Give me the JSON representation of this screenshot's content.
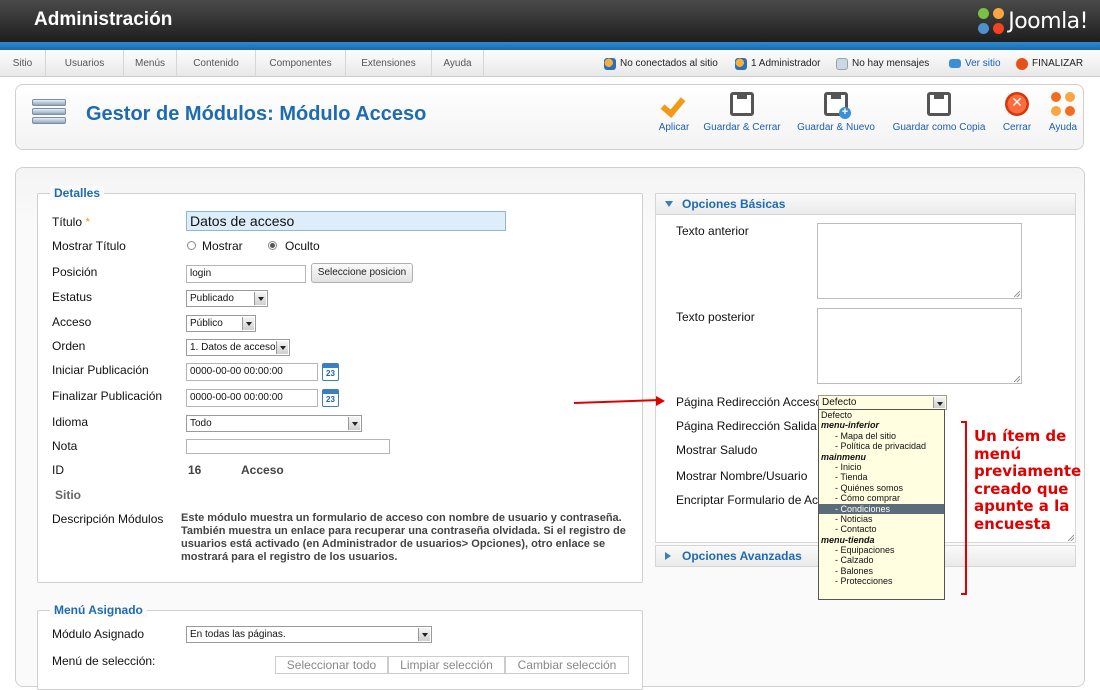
{
  "header": {
    "title": "Administración",
    "logo_text": "Joomla!"
  },
  "menubar": {
    "items": [
      "Sitio",
      "Usuarios",
      "Menús",
      "Contenido",
      "Componentes",
      "Extensiones",
      "Ayuda"
    ]
  },
  "status": {
    "not_connected": "No conectados al sitio",
    "admins": "1 Administrador",
    "messages": "No hay mensajes",
    "view_site": "Ver sitio",
    "logout": "FINALIZAR"
  },
  "toolbar": {
    "page_title": "Gestor de Módulos: Módulo Acceso",
    "buttons": {
      "apply": "Aplicar",
      "save_close": "Guardar & Cerrar",
      "save_new": "Guardar & Nuevo",
      "save_copy": "Guardar como Copia",
      "close": "Cerrar",
      "help": "Ayuda"
    }
  },
  "details": {
    "legend": "Detalles",
    "title_label": "Título",
    "required_mark": "*",
    "title_value": "Datos de acceso",
    "show_title_label": "Mostrar Título",
    "show_option": "Mostrar",
    "hide_option": "Oculto",
    "position_label": "Posición",
    "position_value": "login",
    "select_position_button": "Seleccione posicion",
    "status_label": "Estatus",
    "status_value": "Publicado",
    "access_label": "Acceso",
    "access_value": "Público",
    "order_label": "Orden",
    "order_value": "1. Datos de acceso",
    "start_label": "Iniciar Publicación",
    "start_value": "0000-00-00 00:00:00",
    "finish_label": "Finalizar Publicación",
    "finish_value": "0000-00-00 00:00:00",
    "calendar_text": "23",
    "language_label": "Idioma",
    "language_value": "Todo",
    "note_label": "Nota",
    "note_value": "",
    "id_label": "ID",
    "id_value": "16",
    "id_type": "Acceso",
    "site_label": "Sitio",
    "description_label": "Descripción Módulos",
    "description_text": "Este módulo muestra un formulario de acceso con nombre de usuario y contraseña. También muestra un enlace para recuperar una contraseña olvidada. Si el registro de usuarios está activado (en Administrador de usuarios> Opciones), otro enlace se mostrará para el registro de los usuarios."
  },
  "menu_assignment": {
    "legend": "Menú Asignado",
    "assigned_label": "Módulo Asignado",
    "assigned_value": "En todas las páginas.",
    "selection_label": "Menú de selección:",
    "select_all": "Seleccionar todo",
    "clear_selection": "Limpiar selección",
    "toggle_selection": "Cambiar selección"
  },
  "basic_options": {
    "header": "Opciones Básicas",
    "pretext_label": "Texto anterior",
    "posttext_label": "Texto posterior",
    "login_redirect_label": "Página Redirección Acceso",
    "login_redirect_value": "Defecto",
    "logout_redirect_label": "Página Redirección Salida",
    "greeting_label": "Mostrar Saludo",
    "name_label": "Mostrar Nombre/Usuario",
    "encrypt_label": "Encriptar Formulario de Acce"
  },
  "advanced_options": {
    "header": "Opciones Avanzadas"
  },
  "dropdown": {
    "items": [
      {
        "text": "Defecto",
        "kind": "plain"
      },
      {
        "text": "menu-inferior",
        "kind": "group"
      },
      {
        "text": "- Mapa del sitio",
        "kind": "child"
      },
      {
        "text": "- Política de privacidad",
        "kind": "child"
      },
      {
        "text": "mainmenu",
        "kind": "group"
      },
      {
        "text": "- Inicio",
        "kind": "child"
      },
      {
        "text": "- Tienda",
        "kind": "child"
      },
      {
        "text": "- Quiénes somos",
        "kind": "child"
      },
      {
        "text": "- Cómo comprar",
        "kind": "child"
      },
      {
        "text": "- Condiciones",
        "kind": "child-selected"
      },
      {
        "text": "- Noticias",
        "kind": "child"
      },
      {
        "text": "- Contacto",
        "kind": "child"
      },
      {
        "text": "menu-tienda",
        "kind": "group"
      },
      {
        "text": "- Equipaciones",
        "kind": "child"
      },
      {
        "text": "- Calzado",
        "kind": "child"
      },
      {
        "text": "- Balones",
        "kind": "child"
      },
      {
        "text": "- Protecciones",
        "kind": "child"
      }
    ]
  },
  "annotation": {
    "text": "Un ítem de menú previamente creado que apunte a la encuesta",
    "color": "#e00000"
  },
  "colors": {
    "accent": "#1f6bb1",
    "header_bg": "#2a2a2a",
    "strip": "#2e8bd0",
    "dropdown_bg": "#fffee0",
    "selected_item": "#5a6b7a"
  },
  "icons": {
    "apply": "check-icon",
    "save": "floppy-disk-icon",
    "save_new": "floppy-disk-plus-icon",
    "save_copy": "floppy-disk-copy-icon",
    "close": "close-circle-icon",
    "help": "lifebuoy-icon",
    "calendar": "calendar-icon",
    "module": "module-stack-icon"
  }
}
